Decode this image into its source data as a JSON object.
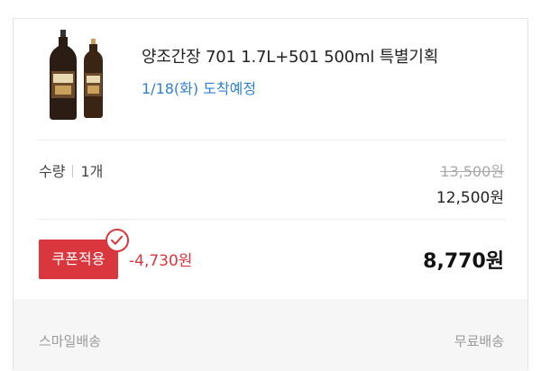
{
  "product": {
    "name": "양조간장 701 1.7L+501 500ml 특별기획",
    "delivery": "1/18(화) 도착예정"
  },
  "quantity": {
    "label": "수량",
    "value": "1개"
  },
  "price": {
    "original": "13,500원",
    "sale": "12,500원"
  },
  "coupon": {
    "button_label": "쿠폰적용",
    "discount": "-4,730원",
    "applied": true
  },
  "total": "8,770원",
  "shipping": {
    "type": "스마일배송",
    "fee": "무료배송"
  },
  "colors": {
    "accent_red": "#d9373d",
    "link_blue": "#2f7fd1"
  }
}
